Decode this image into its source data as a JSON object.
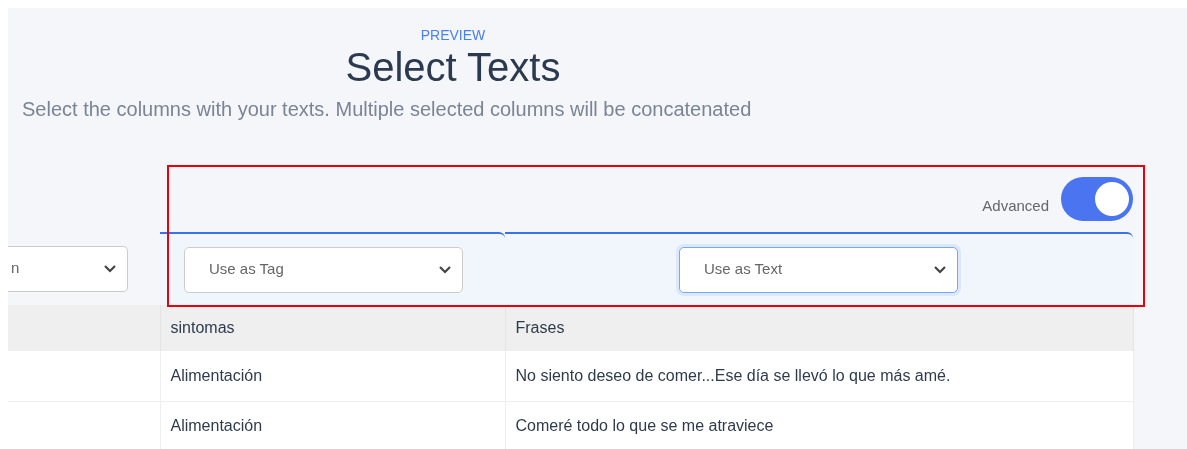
{
  "header": {
    "eyebrow": "PREVIEW",
    "title": "Select Texts",
    "subtitle": "Select the columns with your texts. Multiple selected columns will be concatenated"
  },
  "advanced_toggle": {
    "label": "Advanced",
    "on": true
  },
  "column_selects": [
    {
      "value": "n",
      "focused": false
    },
    {
      "value": "Use as Tag",
      "focused": false
    },
    {
      "value": "Use as Text",
      "focused": true
    }
  ],
  "table": {
    "columns": [
      "sintomas",
      "Frases"
    ],
    "rows": [
      [
        "Alimentación",
        "No siento deseo de comer...Ese día se llevó lo que más amé."
      ],
      [
        "Alimentación",
        "Comeré todo lo que se me atraviece"
      ]
    ]
  },
  "annotation": {
    "kind": "highlight"
  }
}
